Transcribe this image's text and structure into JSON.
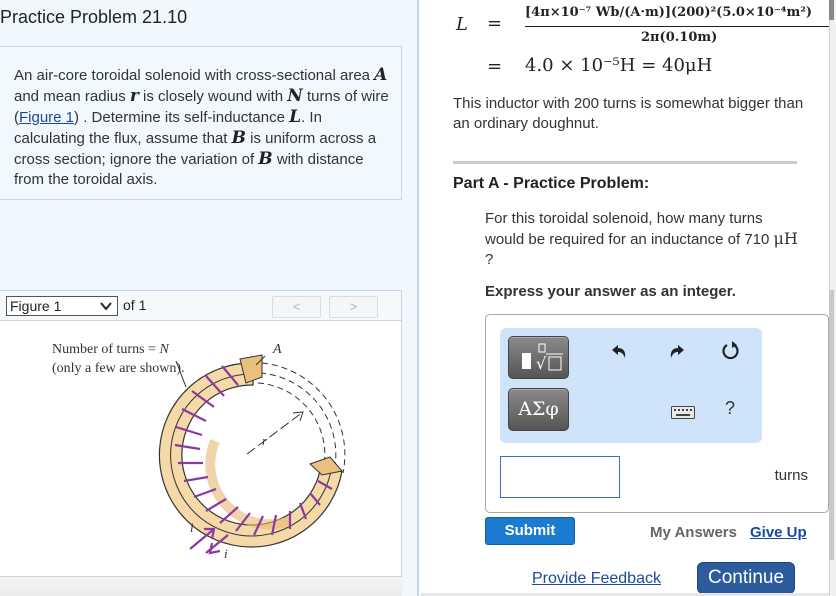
{
  "left": {
    "title": "Practice Problem 21.10",
    "intro": {
      "t1": "An air-core toroidal solenoid with cross-sectional area ",
      "A": "A",
      "t2": " and mean radius ",
      "r": "r",
      "t3": " is closely wound with ",
      "N": "N",
      "t4": " turns of wire (",
      "link": "Figure 1",
      "t5": ") . Determine its self-inductance ",
      "L": "L",
      "t6": ". In calculating the flux, assume that ",
      "B1": "B",
      "t7": " is uniform across a cross section; ignore the variation of ",
      "B2": "B",
      "t8": " with distance from the toroidal axis."
    },
    "figure": {
      "select_value": "Figure 1",
      "of_label": "of 1",
      "prev_label": "<",
      "next_label": ">",
      "caption_line1": "Number of turns = ",
      "caption_N": "N",
      "caption_line2": "(only a few are shown).",
      "label_A": "A",
      "label_r": "r",
      "label_i1": "i",
      "label_i2": "i"
    }
  },
  "right": {
    "equation": {
      "lhs": "L",
      "equals": "=",
      "numerator": "[4π×10⁻⁷ Wb/(A·m)](200)²(5.0×10⁻⁴m²)",
      "denominator": "2π(0.10m)",
      "result": "4.0 × 10⁻⁵H = 40μH"
    },
    "note": "This inductor with 200 turns is somewhat bigger than an ordinary doughnut.",
    "part_title": "Part A - Practice Problem:",
    "question_text": "For this toroidal solenoid, how many turns would be required for an inductance of 710 ",
    "question_unit": "μH",
    "question_end": " ?",
    "instruction": "Express your answer as an integer.",
    "toolbar": {
      "templates_icon": "fraction-root-template-icon",
      "greek_label": "ΑΣφ",
      "undo_icon": "undo-icon",
      "redo_icon": "redo-icon",
      "reset_icon": "reset-icon",
      "keyboard_icon": "keyboard-icon",
      "help_label": "?"
    },
    "answer": {
      "value": "",
      "unit": "turns"
    },
    "submit_label": "Submit",
    "my_answers_label": "My Answers",
    "give_up_label": "Give Up",
    "feedback_label": "Provide Feedback",
    "continue_label": "Continue"
  },
  "colors": {
    "submit": "#1a7bd1",
    "continue": "#2d5c9e",
    "link": "#1a4aa0",
    "toolbar_bg": "#cfe3fb",
    "toroid_fill": "#f6d9a8",
    "winding": "#8a3a9e"
  }
}
